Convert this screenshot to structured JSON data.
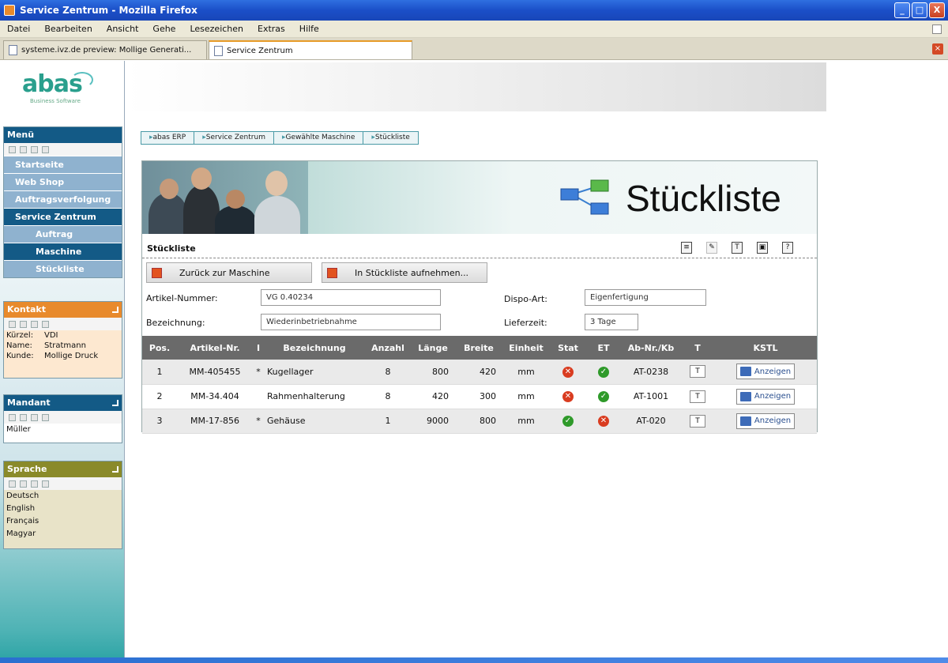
{
  "window": {
    "title": "Service Zentrum - Mozilla Firefox",
    "buttons": [
      "_",
      "□",
      "X"
    ]
  },
  "menubar": [
    "Datei",
    "Bearbeiten",
    "Ansicht",
    "Gehe",
    "Lesezeichen",
    "Extras",
    "Hilfe"
  ],
  "tabs": [
    {
      "label": "systeme.ivz.de preview: Mollige Generati..."
    },
    {
      "label": "Service Zentrum"
    }
  ],
  "sidebar": {
    "logo": {
      "text": "abas",
      "tagline": "Business Software"
    },
    "menu": {
      "title": "Menü",
      "items": [
        "Startseite",
        "Web Shop",
        "Auftragsverfolgung",
        "Service Zentrum",
        "Auftrag",
        "Maschine",
        "Stückliste"
      ]
    },
    "contact": {
      "title": "Kontakt",
      "rows": [
        {
          "k": "Kürzel:",
          "v": "VDI"
        },
        {
          "k": "Name:",
          "v": "Stratmann"
        },
        {
          "k": "Kunde:",
          "v": "Mollige Druck"
        }
      ]
    },
    "customer": {
      "title": "Mandant",
      "value": "Müller"
    },
    "language": {
      "title": "Sprache",
      "options": [
        "Deutsch",
        "English",
        "Français",
        "Magyar"
      ]
    }
  },
  "breadcrumb": [
    "abas ERP",
    "Service Zentrum",
    "Gewählte Maschine",
    "Stückliste"
  ],
  "banner": {
    "title": "Stückliste"
  },
  "section": {
    "title": "Stückliste",
    "tools": [
      "print",
      "edit",
      "save",
      "export",
      "help"
    ]
  },
  "buttons": {
    "back": "Zurück zur Maschine",
    "add": "In Stückliste aufnehmen..."
  },
  "form": {
    "article_label": "Artikel-Nummer:",
    "article_value": "VG 0.40234",
    "name_label": "Bezeichnung:",
    "name_value": "Wiederinbetriebnahme",
    "type_label": "Dispo-Art:",
    "type_value": "Eigenfertigung",
    "lead_label": "Lieferzeit:",
    "lead_value": "3 Tage"
  },
  "grid": {
    "headers": [
      "Pos.",
      "Artikel-Nr.",
      "I",
      "Bezeichnung",
      "Anzahl",
      "Länge",
      "Breite",
      "Einheit",
      "Stat",
      "ET",
      "Ab-Nr./Kb",
      "T",
      "KSTL"
    ],
    "rows": [
      {
        "pos": "1",
        "article": "MM-405455",
        "i": "*",
        "name": "Kugellager",
        "qty": "8",
        "length": "800",
        "width": "420",
        "unit": "mm",
        "stat": "red",
        "et": "green",
        "abnr": "AT-0238",
        "t": "T",
        "action": "Anzeigen"
      },
      {
        "pos": "2",
        "article": "MM-34.404",
        "i": "",
        "name": "Rahmenhalterung",
        "qty": "8",
        "length": "420",
        "width": "300",
        "unit": "mm",
        "stat": "red",
        "et": "green",
        "abnr": "AT-1001",
        "t": "T",
        "action": "Anzeigen"
      },
      {
        "pos": "3",
        "article": "MM-17-856",
        "i": "*",
        "name": "Gehäuse",
        "qty": "1",
        "length": "9000",
        "width": "800",
        "unit": "mm",
        "stat": "green",
        "et": "red",
        "abnr": "AT-020",
        "t": "T",
        "action": "Anzeigen"
      }
    ]
  },
  "colors": {
    "titlebar": "#1b4fc8",
    "nav": "#135a86",
    "grid_header": "#6a6a6a",
    "accent_teal": "#4a9aa6"
  }
}
